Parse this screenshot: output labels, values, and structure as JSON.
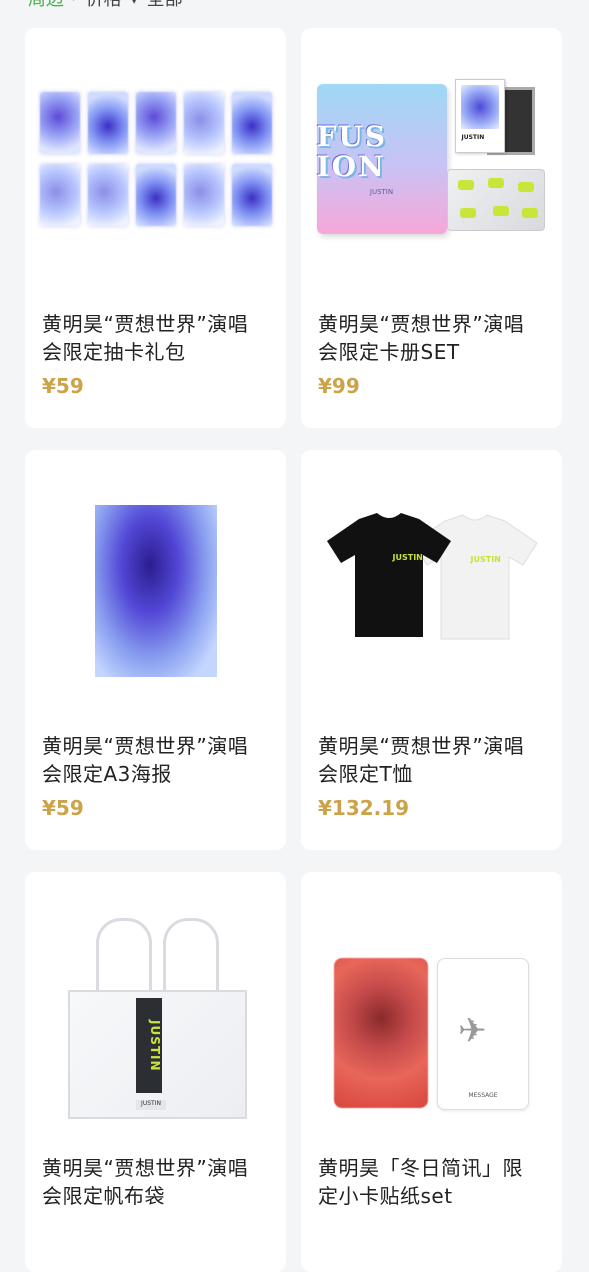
{
  "breadcrumb": {
    "items": [
      "周边",
      "价格",
      "全部"
    ]
  },
  "products": [
    {
      "title": "黄明昊“贾想世界”演唱会限定抽卡礼包",
      "price": "¥59"
    },
    {
      "title": "黄明昊“贾想世界”演唱会限定卡册SET",
      "price": "¥99"
    },
    {
      "title": "黄明昊“贾想世界”演唱会限定A3海报",
      "price": "¥59"
    },
    {
      "title": "黄明昊“贾想世界”演唱会限定T恤",
      "price": "¥132.19"
    },
    {
      "title": "黄明昊“贾想世界”演唱会限定帆布袋",
      "price": ""
    },
    {
      "title": "黄明昊「冬日简讯」限定小卡贴纸set",
      "price": ""
    }
  ],
  "image_text": {
    "box_logo": "FUS ION",
    "box_sub": "JUSTIN",
    "polaroid_label": "JUSTIN",
    "tee_tag": "JUSTIN",
    "bag_strip": "JUSTIN",
    "bag_label": "JUSTIN",
    "msg_card": "MESSAGE"
  },
  "colors": {
    "price": "#cda349",
    "accent_green": "#4caf50",
    "background": "#f4f5f7"
  }
}
